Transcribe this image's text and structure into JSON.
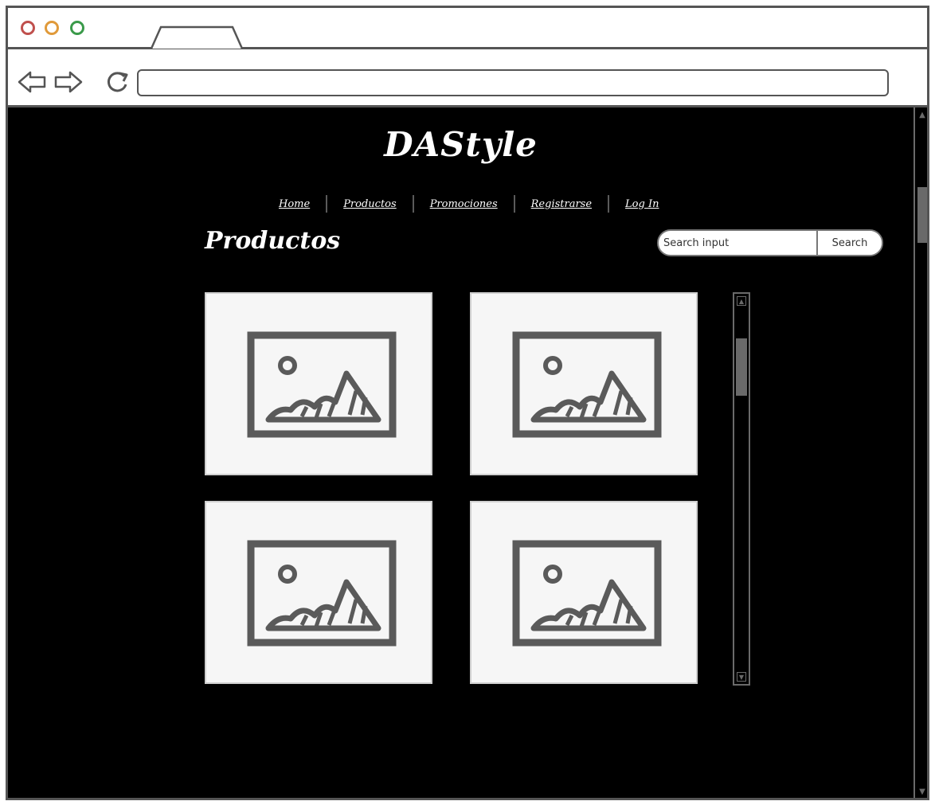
{
  "browser": {
    "window_controls": [
      "close-icon",
      "minimize-icon",
      "maximize-icon"
    ],
    "nav_icons": [
      "back-arrow-icon",
      "forward-arrow-icon",
      "reload-icon"
    ],
    "url": ""
  },
  "site": {
    "title": "DAStyle"
  },
  "menu": {
    "items": [
      {
        "label": "Home"
      },
      {
        "label": "Productos"
      },
      {
        "label": "Promociones"
      },
      {
        "label": "Registrarse"
      },
      {
        "label": "Log In"
      }
    ]
  },
  "section": {
    "title": "Productos"
  },
  "search": {
    "placeholder": "Search input",
    "button_label": "Search"
  },
  "products": [
    {
      "image_icon": "image-placeholder-icon"
    },
    {
      "image_icon": "image-placeholder-icon"
    },
    {
      "image_icon": "image-placeholder-icon"
    },
    {
      "image_icon": "image-placeholder-icon"
    }
  ],
  "colors": {
    "page_background": "#000000",
    "text": "#ffffff",
    "chrome_border": "#555555",
    "card_background": "#f6f6f6",
    "icon_stroke": "#5a5a5a",
    "close_dot": "#c0504d",
    "minimize_dot": "#e09a3a",
    "maximize_dot": "#3a9a4a"
  }
}
